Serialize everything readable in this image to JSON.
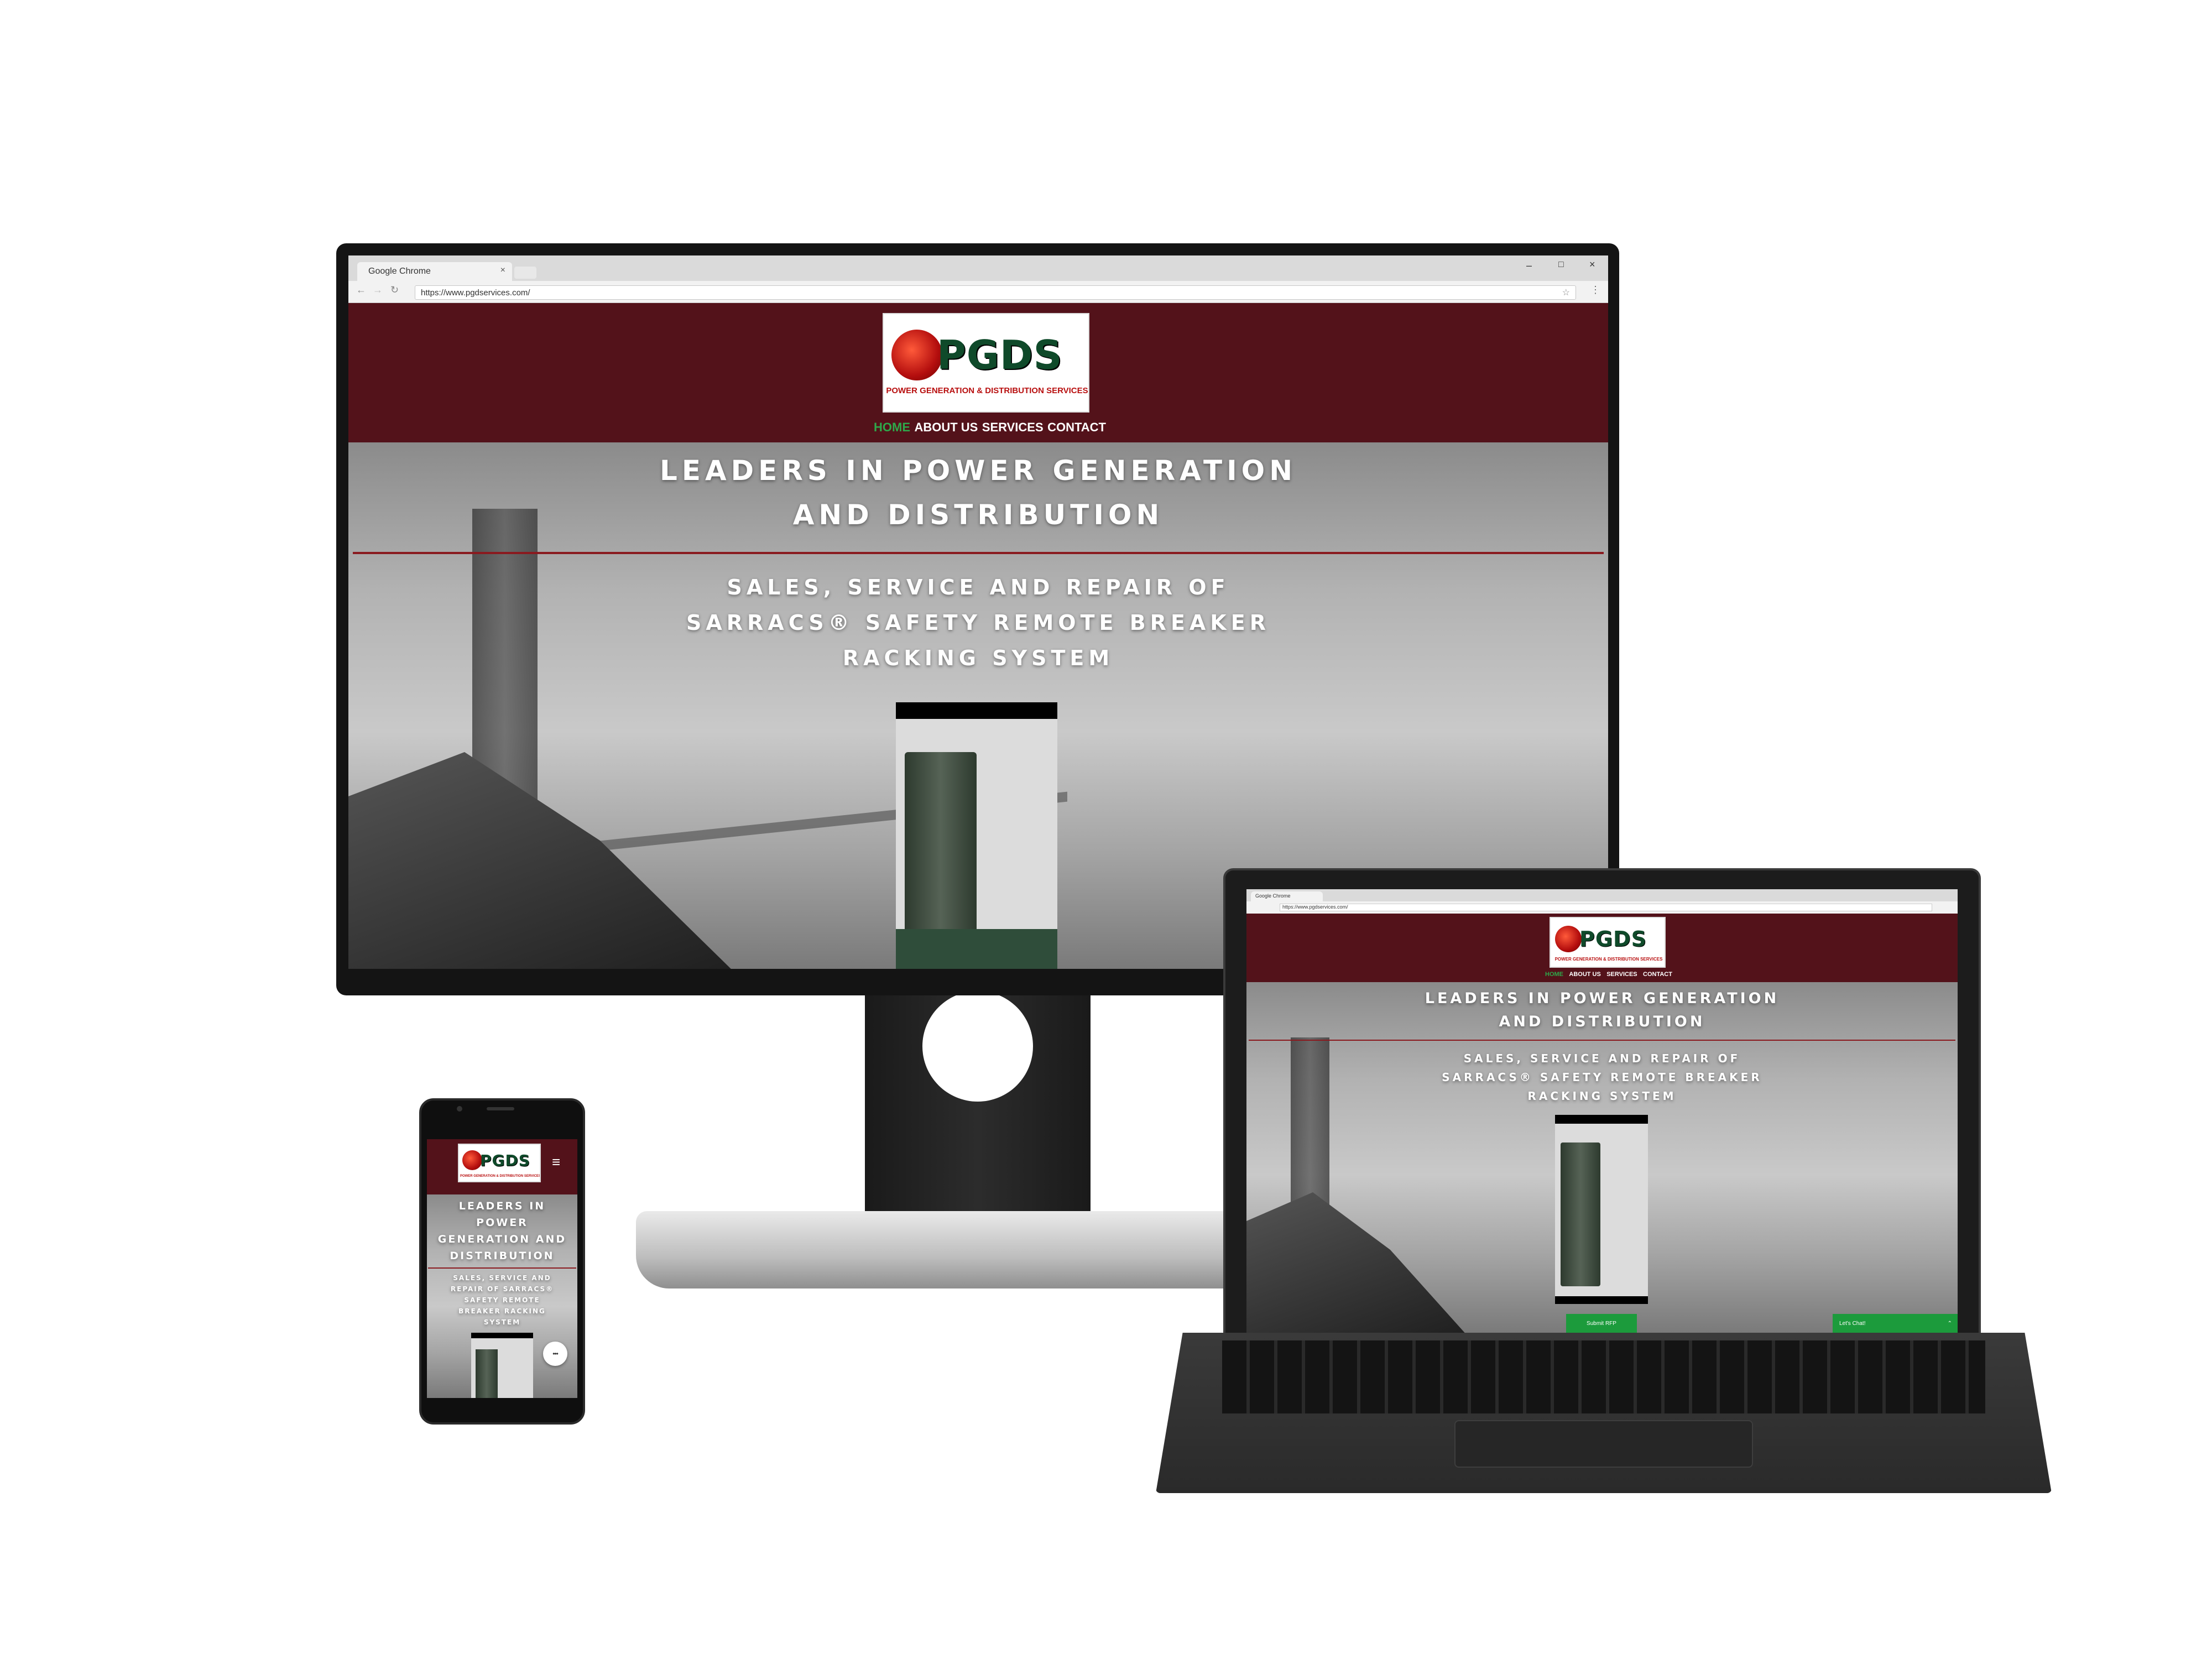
{
  "browser": {
    "window_title": "Google Chrome",
    "url": "https://www.pgdservices.com/",
    "laptop_url": "https://www.pgdservices.com/"
  },
  "site": {
    "logo_text": "PGDS",
    "logo_subtitle": "POWER GENERATION & DISTRIBUTION SERVICES",
    "nav": [
      "HOME",
      "ABOUT US",
      "SERVICES",
      "CONTACT"
    ],
    "headline_line1": "LEADERS IN POWER GENERATION",
    "headline_line2": "AND DISTRIBUTION",
    "subhead_line1": "SALES, SERVICE AND REPAIR OF",
    "subhead_line2": "SARRACS® SAFETY REMOTE BREAKER",
    "subhead_line3": "RACKING SYSTEM",
    "submit_button": "Submit RFP",
    "chat_button": "Let's Chat!"
  },
  "phone": {
    "headline_lines": [
      "LEADERS IN",
      "POWER",
      "GENERATION AND",
      "DISTRIBUTION"
    ],
    "subhead_lines": [
      "SALES, SERVICE AND",
      "REPAIR OF SARRACS®",
      "SAFETY REMOTE",
      "BREAKER RACKING",
      "SYSTEM"
    ],
    "menu_icon": "≡",
    "chat_icon": "•••"
  },
  "colors": {
    "header_bg": "#53121a",
    "nav_active": "#2ea84a",
    "accent_line": "#8a1a1f",
    "button_green": "#1c9b3c"
  }
}
